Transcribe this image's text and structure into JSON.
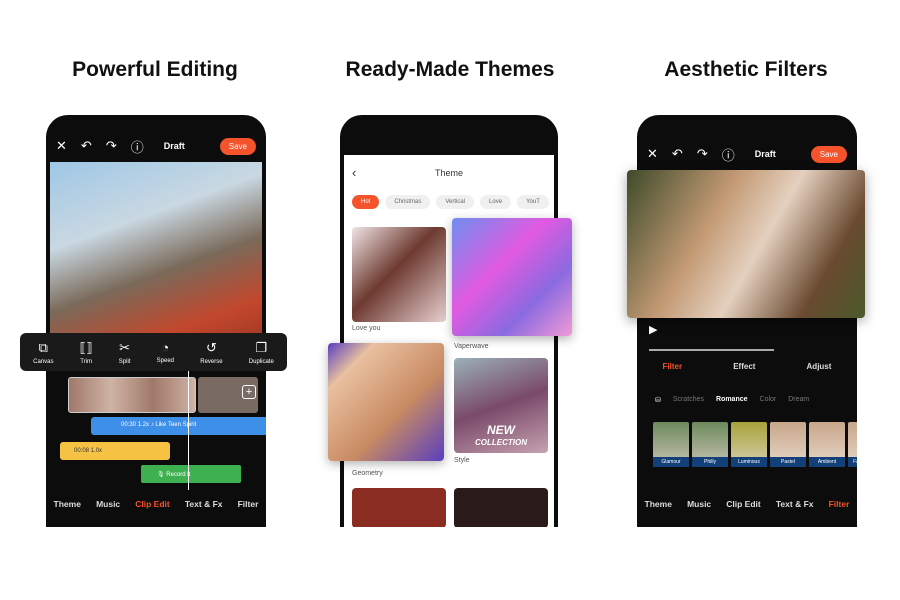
{
  "titles": [
    "Powerful Editing",
    "Ready-Made Themes",
    "Aesthetic Filters"
  ],
  "editor": {
    "draft": "Draft",
    "save": "Save",
    "tools": [
      {
        "icon": "canvas-icon",
        "label": "Canvas"
      },
      {
        "icon": "trim-icon",
        "label": "Trim"
      },
      {
        "icon": "scissors-icon",
        "label": "Split"
      },
      {
        "icon": "speed-icon",
        "label": "Speed"
      },
      {
        "icon": "reverse-icon",
        "label": "Reverse"
      },
      {
        "icon": "duplicate-icon",
        "label": "Duplicate"
      }
    ],
    "clip_time": "00:08",
    "music_track": "Like Teen Spirit",
    "music_time": "00:30",
    "music_speed": "1.2x",
    "sticker_time": "00:08",
    "sticker_speed": "1.0x",
    "record": "Record it",
    "tabs": [
      "Theme",
      "Music",
      "Clip Edit",
      "Text & Fx",
      "Filter"
    ],
    "active_tab": "Clip Edit",
    "accent": "#f4532b"
  },
  "themes": {
    "header": "Theme",
    "chips": [
      "Hot",
      "Christmas",
      "Vertical",
      "Love",
      "YouT"
    ],
    "active_chip": "Hot",
    "cards": [
      "Love you",
      "Vaperwave",
      "Geometry",
      "Style"
    ],
    "overlay_text": [
      "NEW",
      "COLLECTION"
    ]
  },
  "filters": {
    "draft": "Draft",
    "save": "Save",
    "subtabs": [
      "Filter",
      "Effect",
      "Adjust"
    ],
    "active_subtab": "Filter",
    "categories": [
      "Scratches",
      "Romance",
      "Color",
      "Dream"
    ],
    "active_category": "Romance",
    "presets": [
      "Glamour",
      "Philly",
      "Luminous",
      "Pastel",
      "Ambient",
      "Fa"
    ],
    "tabs": [
      "Theme",
      "Music",
      "Clip Edit",
      "Text & Fx",
      "Filter"
    ],
    "active_tab": "Filter"
  }
}
